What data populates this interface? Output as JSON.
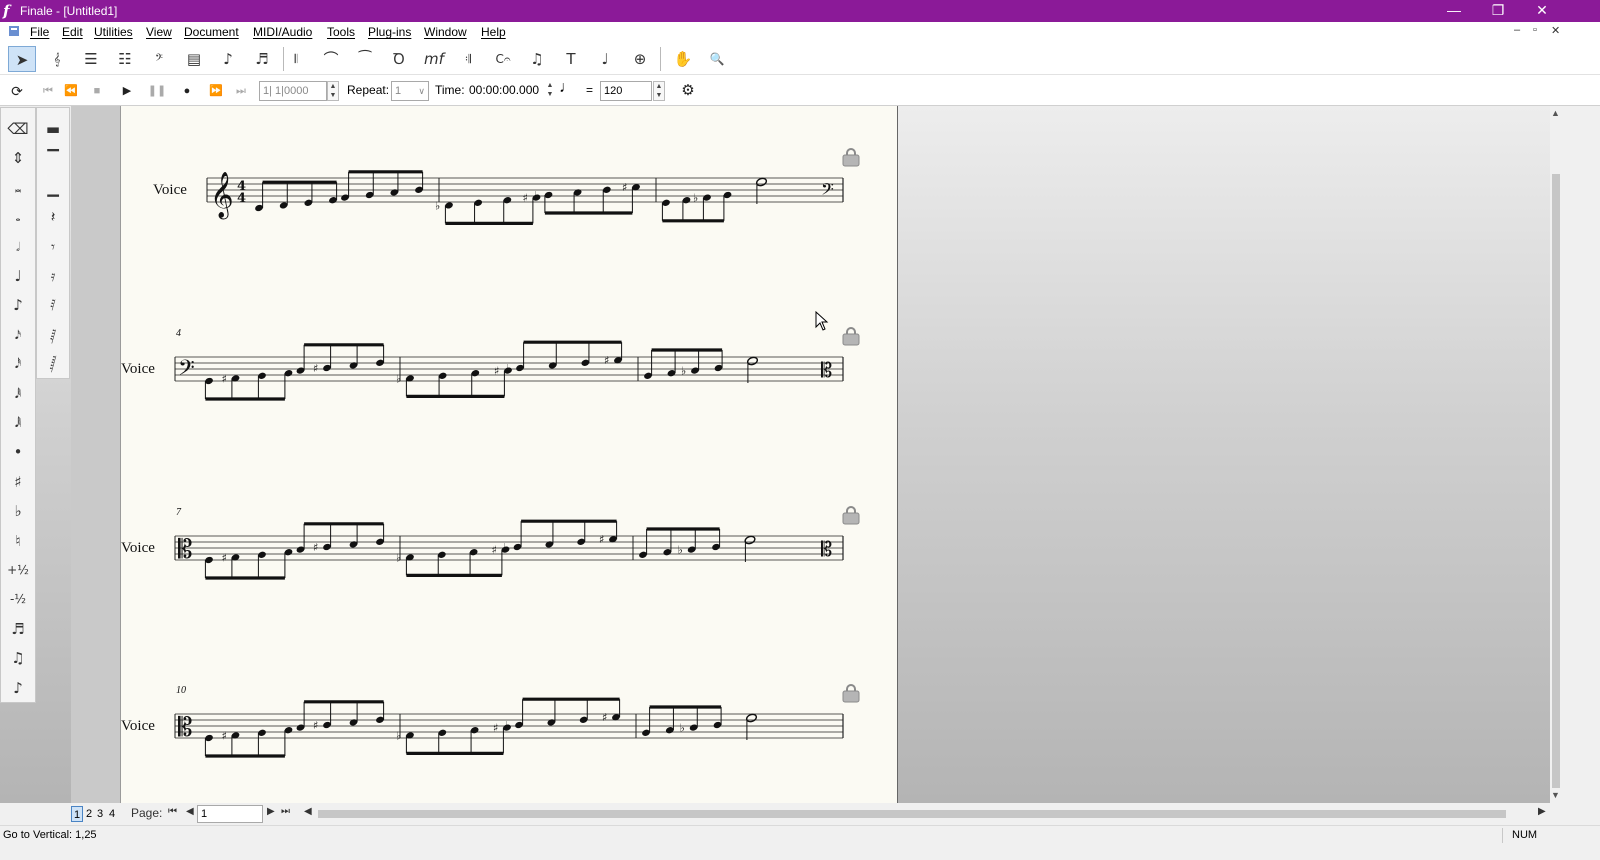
{
  "window": {
    "title": "Finale - [Untitled1]",
    "app_icon": "f",
    "minimize": "—",
    "restore": "❐",
    "close": "✕"
  },
  "menu": [
    "File",
    "Edit",
    "Utilities",
    "View",
    "Document",
    "MIDI/Audio",
    "Tools",
    "Plug-ins",
    "Window",
    "Help"
  ],
  "mdi_controls": [
    "–",
    "▫",
    "✕"
  ],
  "main_tools": [
    {
      "icon": "selection-tool-icon",
      "glyph": "➤",
      "active": true
    },
    {
      "icon": "staff-tool-icon",
      "glyph": "𝄞"
    },
    {
      "icon": "simple-entry-icon",
      "glyph": "☰"
    },
    {
      "icon": "speedy-entry-icon",
      "glyph": "☷"
    },
    {
      "icon": "key-signature-icon",
      "glyph": "𝄢"
    },
    {
      "icon": "measure-tool-icon",
      "glyph": "▤"
    },
    {
      "icon": "note-tool-icon",
      "glyph": "♪"
    },
    {
      "icon": "articulation-tool-icon",
      "glyph": "♬"
    },
    {
      "icon": "mirror-tool-icon",
      "glyph": "𝄃"
    },
    {
      "icon": "tuplet-tool-icon",
      "glyph": "⌒"
    },
    {
      "icon": "smart-shape-icon",
      "glyph": "⁀"
    },
    {
      "icon": "ornament-tool-icon",
      "glyph": "Ꝺ"
    },
    {
      "icon": "expression-tool-icon",
      "glyph": "mf"
    },
    {
      "icon": "repeat-tool-icon",
      "glyph": "𝄇"
    },
    {
      "icon": "chord-tool-icon",
      "glyph": "C𝄐"
    },
    {
      "icon": "lyrics-tool-icon",
      "glyph": "♫"
    },
    {
      "icon": "text-tool-icon",
      "glyph": "T"
    },
    {
      "icon": "resize-tool-icon",
      "glyph": "♩"
    },
    {
      "icon": "graphics-tool-icon",
      "glyph": "⊕"
    },
    {
      "icon": "hand-grabber-icon",
      "glyph": "✋"
    },
    {
      "icon": "zoom-tool-icon",
      "glyph": "🔍"
    }
  ],
  "playback": {
    "measure_value": "1| 1|0000",
    "repeat_label": "Repeat:",
    "repeat_value": "1",
    "time_label": "Time:",
    "time_value": "00:00:00.000",
    "equals": "=",
    "tempo_value": "120"
  },
  "simple_palette_left": [
    {
      "icon": "eraser-icon",
      "glyph": "⌫"
    },
    {
      "icon": "updown-icon",
      "glyph": "⇕"
    },
    {
      "icon": "double-whole-note-icon",
      "glyph": "𝅜"
    },
    {
      "icon": "whole-note-icon",
      "glyph": "𝅝"
    },
    {
      "icon": "half-note-icon",
      "glyph": "𝅗𝅥"
    },
    {
      "icon": "quarter-note-icon",
      "glyph": "♩"
    },
    {
      "icon": "eighth-note-icon",
      "glyph": "♪"
    },
    {
      "icon": "sixteenth-note-icon",
      "glyph": "𝅘𝅥𝅯"
    },
    {
      "icon": "thirty-second-note-icon",
      "glyph": "𝅘𝅥𝅰"
    },
    {
      "icon": "sixty-fourth-note-icon",
      "glyph": "𝅘𝅥𝅱"
    },
    {
      "icon": "hundred-twenty-eighth-note-icon",
      "glyph": "𝅘𝅥𝅲"
    },
    {
      "icon": "dot-icon",
      "glyph": "•"
    },
    {
      "icon": "sharp-icon",
      "glyph": "♯"
    },
    {
      "icon": "flat-icon",
      "glyph": "♭"
    },
    {
      "icon": "natural-icon",
      "glyph": "♮"
    },
    {
      "icon": "half-step-up-icon",
      "glyph": "+½"
    },
    {
      "icon": "half-step-down-icon",
      "glyph": "-½"
    },
    {
      "icon": "tie-icon",
      "glyph": "♬"
    },
    {
      "icon": "tuplet-icon",
      "glyph": "♫"
    },
    {
      "icon": "grace-note-icon",
      "glyph": "♪"
    }
  ],
  "simple_palette_right": [
    {
      "icon": "double-whole-rest-icon",
      "glyph": "▬"
    },
    {
      "icon": "whole-rest-icon",
      "glyph": "▔"
    },
    {
      "icon": "half-rest-icon",
      "glyph": "▁"
    },
    {
      "icon": "quarter-rest-icon",
      "glyph": "𝄽"
    },
    {
      "icon": "eighth-rest-icon",
      "glyph": "𝄾"
    },
    {
      "icon": "sixteenth-rest-icon",
      "glyph": "𝄿"
    },
    {
      "icon": "thirty-second-rest-icon",
      "glyph": "𝅀"
    },
    {
      "icon": "sixty-fourth-rest-icon",
      "glyph": "𝅁"
    },
    {
      "icon": "hundred-twenty-eighth-rest-icon",
      "glyph": "𝅂"
    }
  ],
  "score": {
    "systems": [
      {
        "staff_name": "Voice",
        "measure_number": ""
      },
      {
        "staff_name": "Voice",
        "measure_number": "4"
      },
      {
        "staff_name": "Voice",
        "measure_number": "7"
      },
      {
        "staff_name": "Voice",
        "measure_number": "10"
      }
    ]
  },
  "page_tabs": [
    "1",
    "2",
    "3",
    "4"
  ],
  "page_nav": {
    "label": "Page:",
    "value": "1"
  },
  "status": {
    "message": "Go to Vertical: 1,25",
    "num": "NUM"
  }
}
